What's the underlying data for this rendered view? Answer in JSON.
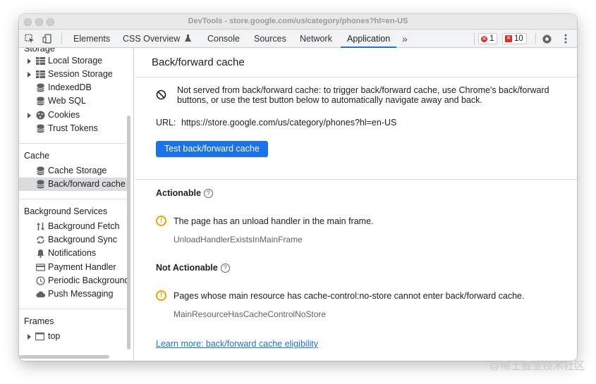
{
  "window": {
    "title": "DevTools - store.google.com/us/category/phones?hl=en-US"
  },
  "toolbar": {
    "tabs": [
      {
        "label": "Elements"
      },
      {
        "label": "CSS Overview"
      },
      {
        "label": "Console"
      },
      {
        "label": "Sources"
      },
      {
        "label": "Network"
      },
      {
        "label": "Application"
      }
    ],
    "more_tabs": "»",
    "error_count": "1",
    "issue_count": "10"
  },
  "sidebar": {
    "partial_header": "Storage",
    "storage_items": [
      {
        "label": "Local Storage",
        "icon": "grid-icon"
      },
      {
        "label": "Session Storage",
        "icon": "grid-icon"
      },
      {
        "label": "IndexedDB",
        "icon": "database-icon"
      },
      {
        "label": "Web SQL",
        "icon": "database-icon"
      },
      {
        "label": "Cookies",
        "icon": "cookie-icon"
      },
      {
        "label": "Trust Tokens",
        "icon": "database-icon"
      }
    ],
    "cache_header": "Cache",
    "cache_items": [
      {
        "label": "Cache Storage"
      },
      {
        "label": "Back/forward cache"
      }
    ],
    "bg_header": "Background Services",
    "bg_items": [
      {
        "label": "Background Fetch"
      },
      {
        "label": "Background Sync"
      },
      {
        "label": "Notifications"
      },
      {
        "label": "Payment Handler"
      },
      {
        "label": "Periodic Background"
      },
      {
        "label": "Push Messaging"
      }
    ],
    "frames_header": "Frames",
    "frames_items": [
      {
        "label": "top"
      }
    ]
  },
  "main": {
    "title": "Back/forward cache",
    "status_message": "Not served from back/forward cache: to trigger back/forward cache, use Chrome's back/forward buttons, or use the test button below to automatically navigate away and back.",
    "url_label": "URL:",
    "url_value": "https://store.google.com/us/category/phones?hl=en-US",
    "test_button": "Test back/forward cache",
    "actionable_title": "Actionable",
    "actionable_reason": "The page has an unload handler in the main frame.",
    "actionable_code": "UnloadHandlerExistsInMainFrame",
    "not_actionable_title": "Not Actionable",
    "not_actionable_reason": "Pages whose main resource has cache-control:no-store cannot enter back/forward cache.",
    "not_actionable_code": "MainResourceHasCacheControlNoStore",
    "learn_more": "Learn more: back/forward cache eligibility"
  },
  "watermark": "@稀土掘金技术社区"
}
